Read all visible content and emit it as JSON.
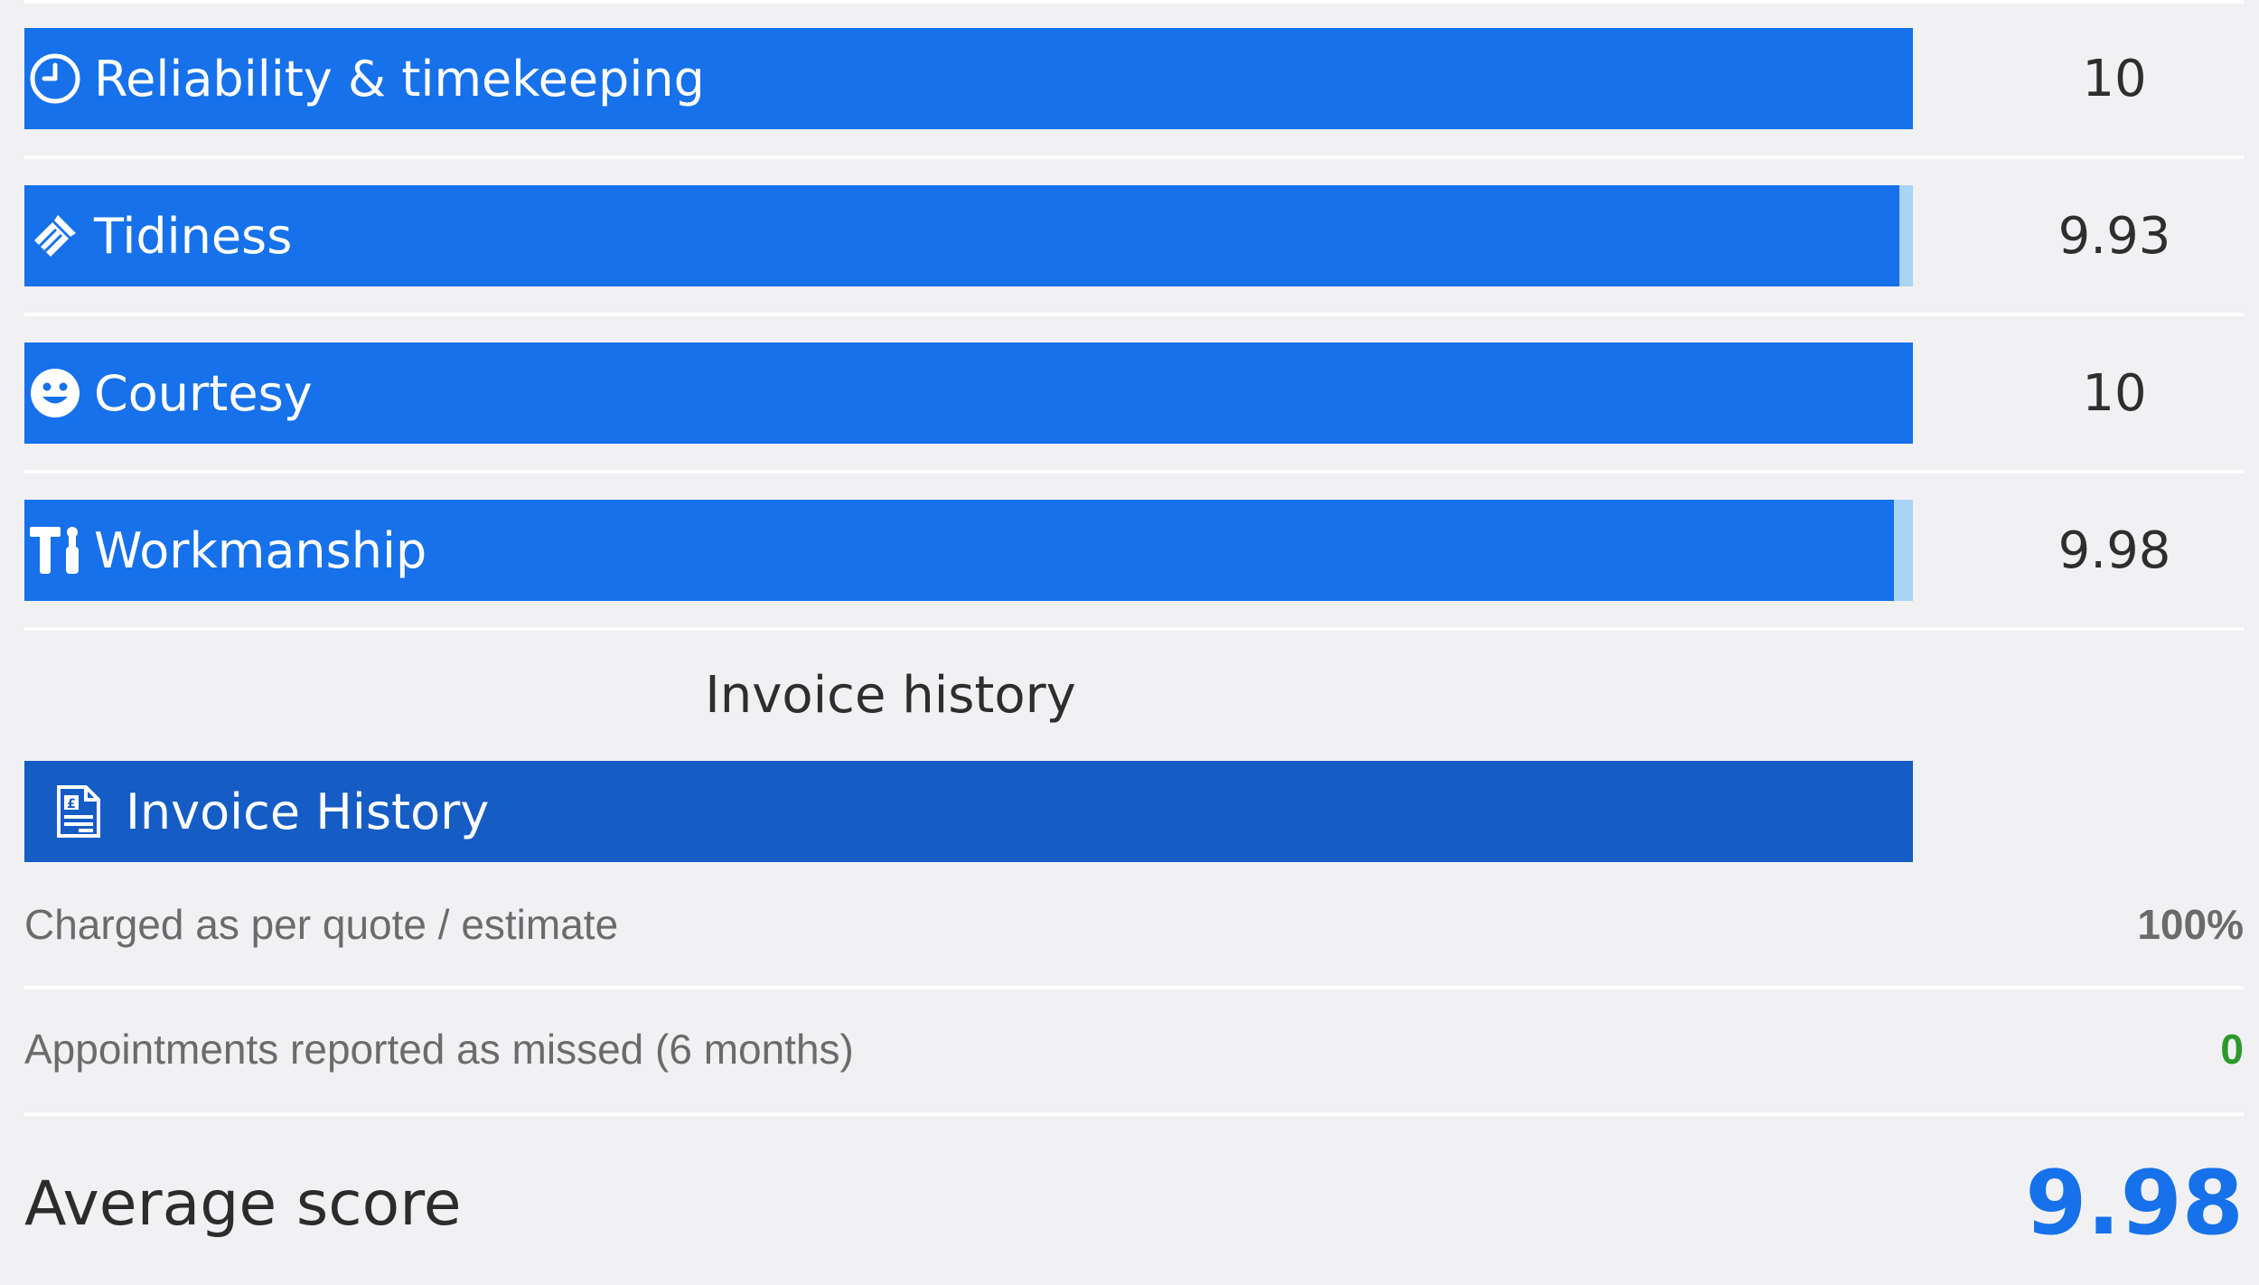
{
  "scores": [
    {
      "label": "Reliability & timekeeping",
      "value": "10",
      "fraction": 1.0,
      "icon": "clock-icon"
    },
    {
      "label": "Tidiness",
      "value": "9.93",
      "fraction": 0.993,
      "icon": "broom-icon"
    },
    {
      "label": "Courtesy",
      "value": "10",
      "fraction": 1.0,
      "icon": "smiley-icon"
    },
    {
      "label": "Workmanship",
      "value": "9.98",
      "fraction": 0.99,
      "icon": "tools-icon"
    }
  ],
  "invoice": {
    "section_title": "Invoice history",
    "bar_label": "Invoice History",
    "icon": "invoice-icon"
  },
  "stats": [
    {
      "label": "Charged as per quote / estimate",
      "value": "100%",
      "color": "#6b6b6b"
    },
    {
      "label": "Appointments reported as missed (6 months)",
      "value": "0",
      "color": "#2a9a2a"
    }
  ],
  "average": {
    "label": "Average score",
    "value": "9.98"
  },
  "colors": {
    "bar_fill": "#1671ea",
    "bar_track": "#a8d4f5",
    "invoice_bar": "#155cc5",
    "background": "#f1f1f4",
    "accent": "#1671ea"
  }
}
